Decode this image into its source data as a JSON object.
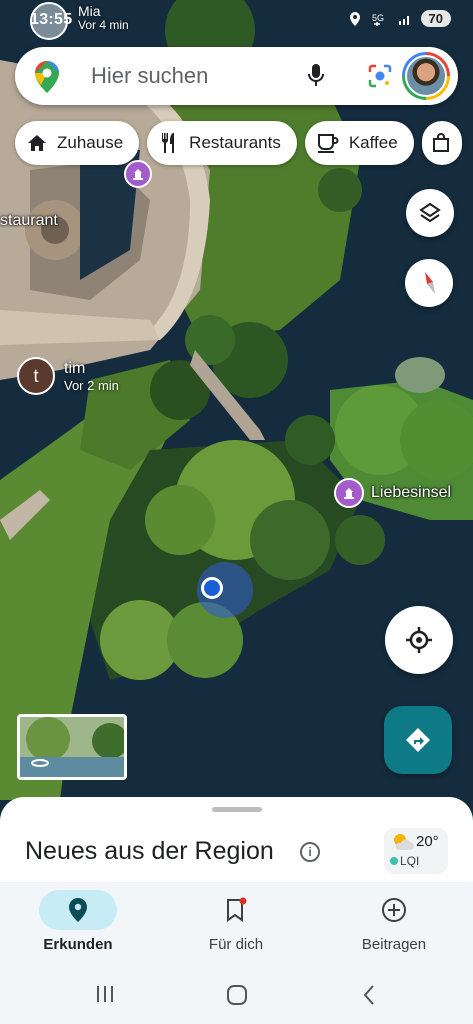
{
  "status": {
    "time": "13:55",
    "battery": "70"
  },
  "friends": {
    "mia": {
      "name": "Mia",
      "time": "Vor 4 min"
    },
    "tim": {
      "initial": "t",
      "name": "tim",
      "time": "Vor 2 min"
    }
  },
  "search": {
    "placeholder": "Hier suchen"
  },
  "chips": [
    {
      "label": "Zuhause",
      "icon": "home-icon"
    },
    {
      "label": "Restaurants",
      "icon": "cutlery-icon"
    },
    {
      "label": "Kaffee",
      "icon": "coffee-icon"
    }
  ],
  "map": {
    "labels": {
      "restaurant": "staurant",
      "island": "Liebesinsel"
    }
  },
  "sheet": {
    "title": "Neues aus der Region",
    "temperature": "20°",
    "air_quality": "LQI"
  },
  "nav": {
    "items": [
      {
        "label": "Erkunden",
        "icon": "explore-pin-icon",
        "active": true
      },
      {
        "label": "Für dich",
        "icon": "bookmark-icon",
        "active": false
      },
      {
        "label": "Beitragen",
        "icon": "add-circle-icon",
        "active": false
      }
    ]
  },
  "colors": {
    "accent": "#0d7a86",
    "active_nav": "#c7ecf6",
    "poi": "#a35cc9",
    "location": "#1a5fd6"
  }
}
